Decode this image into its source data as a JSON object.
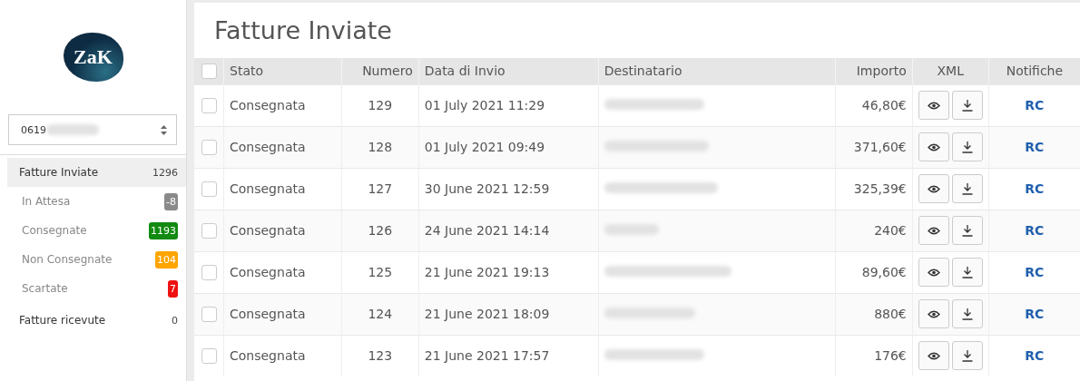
{
  "logo": {
    "text": "ZaK"
  },
  "account_select": {
    "value": "0619"
  },
  "sidebar": {
    "items": [
      {
        "kind": "main",
        "label": "Fatture Inviate",
        "count": "1296",
        "selected": true
      },
      {
        "kind": "sub",
        "label": "In Attesa",
        "count": "-8",
        "color": "#8a8a8a",
        "selected": false
      },
      {
        "kind": "sub",
        "label": "Consegnate",
        "count": "1193",
        "color": "#118a11",
        "selected": false
      },
      {
        "kind": "sub",
        "label": "Non Consegnate",
        "count": "104",
        "color": "#ffa500",
        "selected": false
      },
      {
        "kind": "sub",
        "label": "Scartate",
        "count": "7",
        "color": "#ee1111",
        "selected": false
      },
      {
        "kind": "main",
        "label": "Fatture ricevute",
        "count": "0",
        "selected": false
      }
    ]
  },
  "page_title": "Fatture Inviate",
  "table": {
    "select_all_checked": false,
    "columns": [
      "Stato",
      "Numero",
      "Data di Invio",
      "Destinatario",
      "Importo",
      "XML",
      "Notifiche"
    ],
    "rows": [
      {
        "checked": false,
        "stato": "Consegnata",
        "numero": "129",
        "data": "01 July 2021 11:29",
        "importo": "46,80€",
        "notifiche": "RC"
      },
      {
        "checked": false,
        "stato": "Consegnata",
        "numero": "128",
        "data": "01 July 2021 09:49",
        "importo": "371,60€",
        "notifiche": "RC"
      },
      {
        "checked": false,
        "stato": "Consegnata",
        "numero": "127",
        "data": "30 June 2021 12:59",
        "importo": "325,39€",
        "notifiche": "RC"
      },
      {
        "checked": false,
        "stato": "Consegnata",
        "numero": "126",
        "data": "24 June 2021 14:14",
        "importo": "240€",
        "notifiche": "RC"
      },
      {
        "checked": false,
        "stato": "Consegnata",
        "numero": "125",
        "data": "21 June 2021 19:13",
        "importo": "89,60€",
        "notifiche": "RC"
      },
      {
        "checked": false,
        "stato": "Consegnata",
        "numero": "124",
        "data": "21 June 2021 18:09",
        "importo": "880€",
        "notifiche": "RC"
      },
      {
        "checked": false,
        "stato": "Consegnata",
        "numero": "123",
        "data": "21 June 2021 17:57",
        "importo": "176€",
        "notifiche": "RC"
      }
    ]
  }
}
